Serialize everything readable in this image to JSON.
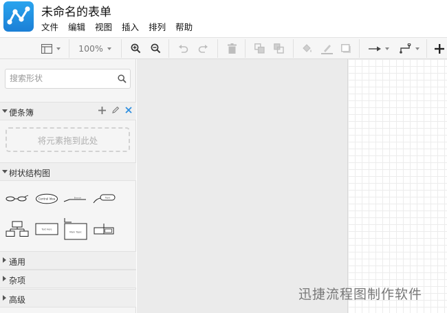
{
  "app": {
    "title": "未命名的表单",
    "logo_icon": "flow-nodes-icon",
    "brand_color": "#1f8fe4"
  },
  "menu": [
    "文件",
    "编辑",
    "视图",
    "插入",
    "排列",
    "帮助"
  ],
  "toolbar": {
    "zoom": "100%",
    "icons": [
      "panel-layout-icon",
      "zoom-in-icon",
      "zoom-out-icon",
      "undo-icon",
      "redo-icon",
      "delete-icon",
      "to-front-icon",
      "to-back-icon",
      "fill-color-icon",
      "line-color-icon",
      "shadow-icon",
      "connection-style-icon",
      "waypoint-icon",
      "add-icon"
    ]
  },
  "sidebar": {
    "search_placeholder": "搜索形状",
    "scratchpad": {
      "title": "便条簿",
      "drop_hint": "将元素拖到此处"
    },
    "tree": {
      "title": "树状结构图",
      "shapes": [
        "org-branch-shape",
        "central-idea-ellipse-shape",
        "topic-line-shape",
        "sub-topic-shape",
        "org-chart-shape",
        "topic-box-shape",
        "main-topic-box-shape",
        "container-shape"
      ],
      "shape_texts": [
        "Central Idea",
        "Branch",
        "Topic",
        "Text Here",
        "Main Topic"
      ]
    },
    "sections": [
      {
        "title": "通用"
      },
      {
        "title": "杂项"
      },
      {
        "title": "高级"
      }
    ]
  },
  "watermark": "迅捷流程图制作软件"
}
